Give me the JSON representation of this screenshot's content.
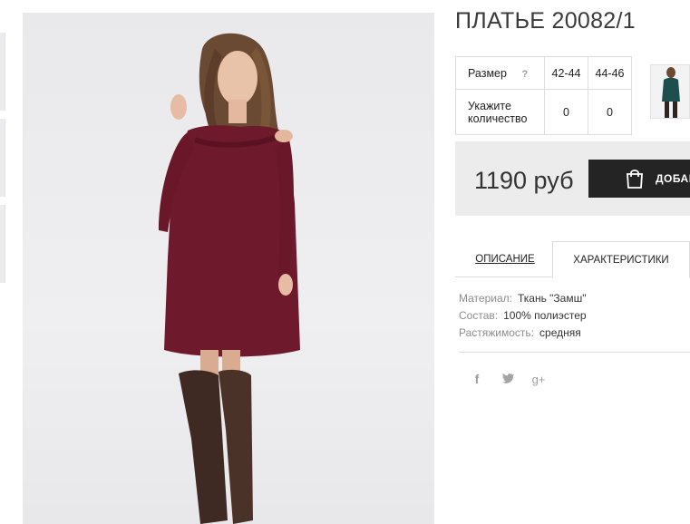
{
  "product": {
    "title": "ПЛАТЬЕ 20082/1",
    "price": "1190 руб",
    "add_to_cart_label": "ДОБАВ"
  },
  "size_table": {
    "size_label": "Размер",
    "help_icon": "?",
    "sizes": [
      "42-44",
      "44-46"
    ],
    "quantity_label": "Укажите количество",
    "quantities": [
      "0",
      "0"
    ]
  },
  "tabs": {
    "description": "ОПИСАНИЕ",
    "characteristics": "ХАРАКТЕРИСТИКИ",
    "active": "characteristics"
  },
  "characteristics": [
    {
      "key": "Материал:",
      "value": "Ткань \"Замш\""
    },
    {
      "key": "Состав:",
      "value": "100% полиэстер"
    },
    {
      "key": "Растяжимость:",
      "value": "средняя"
    }
  ],
  "social": {
    "facebook": "f",
    "twitter": "t",
    "google_plus": "g+"
  },
  "colors": {
    "dress": "#6e1a2c",
    "boots": "#3e2a22",
    "button_bg": "#242424",
    "price_bg": "#ececec"
  },
  "icons": [
    "bag-icon",
    "question-icon",
    "facebook-icon",
    "twitter-icon",
    "google-plus-icon"
  ]
}
